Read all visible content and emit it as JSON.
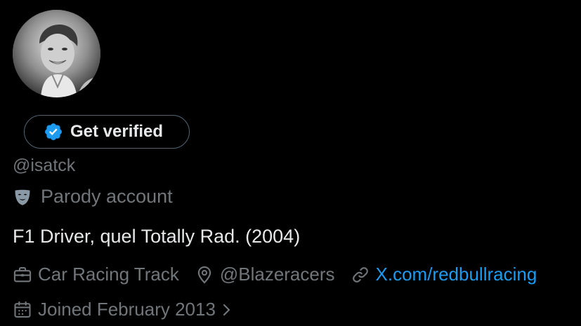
{
  "profile": {
    "avatar_icon": "profile-photo",
    "verify_button_label": "Get verified",
    "verify_badge_color": "#1d9bf0",
    "handle": "@isatck",
    "parody_label": "Parody account",
    "parody_icon": "theater-mask-icon",
    "bio": "F1 Driver, quel Totally Rad. (2004)"
  },
  "meta": {
    "category": "Car Racing Track",
    "category_icon": "briefcase-icon",
    "location": "@Blazeracers",
    "location_icon": "map-pin-icon",
    "url": "X.com/redbullracing",
    "url_icon": "link-icon",
    "link_color": "#1d9bf0",
    "joined": "Joined February 2013",
    "joined_icon": "calendar-icon"
  }
}
